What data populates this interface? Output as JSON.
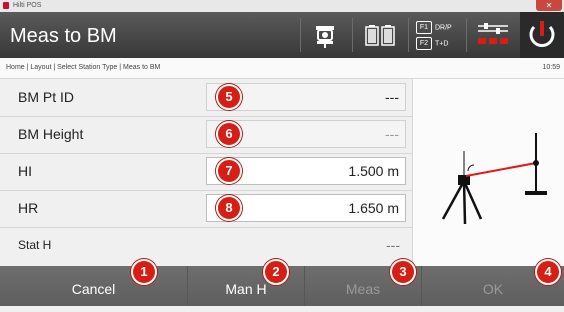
{
  "window": {
    "title": "Hilti POS",
    "close_glyph": "✕"
  },
  "header": {
    "title": "Meas to BM",
    "fkeys": [
      {
        "key": "F1",
        "label": "DR/P"
      },
      {
        "key": "F2",
        "label": "T+D"
      }
    ],
    "icons": [
      "instrument-icon",
      "battery-icon",
      "settings-sliders-icon",
      "power-icon"
    ]
  },
  "breadcrumb": "Home | Layout | Select Station Type | Meas to BM",
  "time": "10:59",
  "rows": [
    {
      "label": "BM Pt ID",
      "value": "---",
      "badge": "5"
    },
    {
      "label": "BM Height",
      "value": "---",
      "badge": "6"
    },
    {
      "label": "HI",
      "value": "1.500 m",
      "badge": "7"
    },
    {
      "label": "HR",
      "value": "1.650 m",
      "badge": "8"
    },
    {
      "label": "Stat H",
      "value": "---"
    }
  ],
  "softkeys": [
    {
      "label": "Cancel",
      "badge": "1",
      "enabled": true
    },
    {
      "label": "Man H",
      "badge": "2",
      "enabled": true
    },
    {
      "label": "Meas",
      "badge": "3",
      "enabled": false
    },
    {
      "label": "OK",
      "badge": "4",
      "enabled": false
    }
  ],
  "colors": {
    "accent": "#d71e14",
    "header": "#3f3f3f",
    "softkey_bar": "#6b6b6b"
  }
}
